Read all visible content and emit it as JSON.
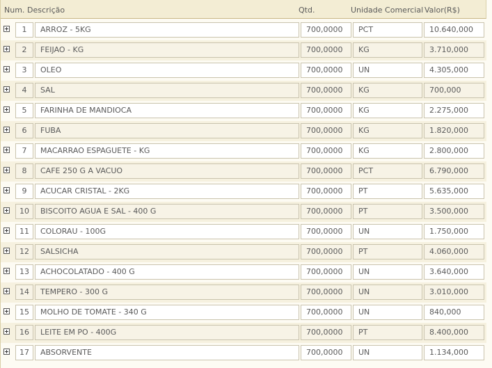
{
  "columns": {
    "num": "Num.",
    "descricao": "Descrição",
    "qtd": "Qtd.",
    "unidade": "Unidade Comercial",
    "valor": "Valor(R$)"
  },
  "items": [
    {
      "num": "1",
      "descricao": "ARROZ - 5KG",
      "qtd": "700,0000",
      "unidade": "PCT",
      "valor": "10.640,000"
    },
    {
      "num": "2",
      "descricao": "FEIJAO - KG",
      "qtd": "700,0000",
      "unidade": "KG",
      "valor": "3.710,000"
    },
    {
      "num": "3",
      "descricao": "OLEO",
      "qtd": "700,0000",
      "unidade": "UN",
      "valor": "4.305,000"
    },
    {
      "num": "4",
      "descricao": "SAL",
      "qtd": "700,0000",
      "unidade": "KG",
      "valor": "700,000"
    },
    {
      "num": "5",
      "descricao": "FARINHA DE MANDIOCA",
      "qtd": "700,0000",
      "unidade": "KG",
      "valor": "2.275,000"
    },
    {
      "num": "6",
      "descricao": "FUBA",
      "qtd": "700,0000",
      "unidade": "KG",
      "valor": "1.820,000"
    },
    {
      "num": "7",
      "descricao": "MACARRAO ESPAGUETE - KG",
      "qtd": "700,0000",
      "unidade": "KG",
      "valor": "2.800,000"
    },
    {
      "num": "8",
      "descricao": "CAFE 250 G A VACUO",
      "qtd": "700,0000",
      "unidade": "PCT",
      "valor": "6.790,000"
    },
    {
      "num": "9",
      "descricao": "ACUCAR CRISTAL - 2KG",
      "qtd": "700,0000",
      "unidade": "PT",
      "valor": "5.635,000"
    },
    {
      "num": "10",
      "descricao": "BISCOITO AGUA E SAL - 400 G",
      "qtd": "700,0000",
      "unidade": "PT",
      "valor": "3.500,000"
    },
    {
      "num": "11",
      "descricao": "COLORAU - 100G",
      "qtd": "700,0000",
      "unidade": "UN",
      "valor": "1.750,000"
    },
    {
      "num": "12",
      "descricao": "SALSICHA",
      "qtd": "700,0000",
      "unidade": "PT",
      "valor": "4.060,000"
    },
    {
      "num": "13",
      "descricao": "ACHOCOLATADO - 400 G",
      "qtd": "700,0000",
      "unidade": "UN",
      "valor": "3.640,000"
    },
    {
      "num": "14",
      "descricao": "TEMPERO - 300 G",
      "qtd": "700,0000",
      "unidade": "UN",
      "valor": "3.010,000"
    },
    {
      "num": "15",
      "descricao": "MOLHO DE TOMATE - 340 G",
      "qtd": "700,0000",
      "unidade": "UN",
      "valor": "840,000"
    },
    {
      "num": "16",
      "descricao": "LEITE EM PO - 400G",
      "qtd": "700,0000",
      "unidade": "PT",
      "valor": "8.400,000"
    },
    {
      "num": "17",
      "descricao": "ABSORVENTE",
      "qtd": "700,0000",
      "unidade": "UN",
      "valor": "1.134,000"
    }
  ]
}
